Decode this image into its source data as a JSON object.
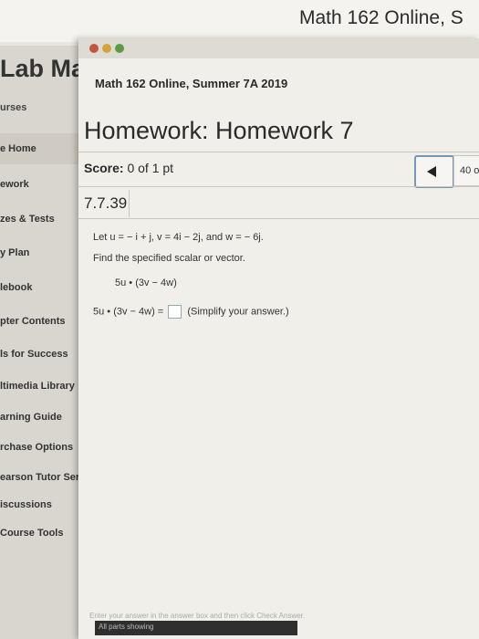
{
  "browser": {
    "window_title": "Math 162 Online, S"
  },
  "sidebar": {
    "lab_title": "Lab Ma",
    "items": [
      {
        "label": "urses"
      },
      {
        "label": "e Home"
      },
      {
        "label": "ework"
      },
      {
        "label": "zes & Tests"
      },
      {
        "label": "y Plan"
      },
      {
        "label": "lebook"
      },
      {
        "label": "pter Contents"
      },
      {
        "label": "ls for Success"
      },
      {
        "label": "ltimedia Library"
      },
      {
        "label": "arning Guide"
      },
      {
        "label": "rchase Options"
      },
      {
        "label": "earson Tutor Services"
      },
      {
        "label": "iscussions"
      },
      {
        "label": "Course Tools"
      }
    ]
  },
  "popup": {
    "course_title": "Math 162 Online, Summer 7A 2019",
    "homework_title": "Homework: Homework 7",
    "score_label": "Score:",
    "score_value": "0 of 1 pt",
    "pager_text": "40 o",
    "problem_id": "7.7.39",
    "problem_statement": "Let u = − i + j, v = 4i − 2j, and w = − 6j.",
    "instruction": "Find the specified scalar or vector.",
    "expression": "5u • (3v − 4w)",
    "answer_lhs": "5u • (3v − 4w) =",
    "answer_hint": "(Simplify your answer.)",
    "answer_value": "",
    "footer_instruction": "Enter your answer in the answer box and then click Check Answer.",
    "parts_label": "All parts showing"
  },
  "colors": {
    "accent_border": "#7a96b5",
    "footer_bar": "#2f2f2f"
  }
}
